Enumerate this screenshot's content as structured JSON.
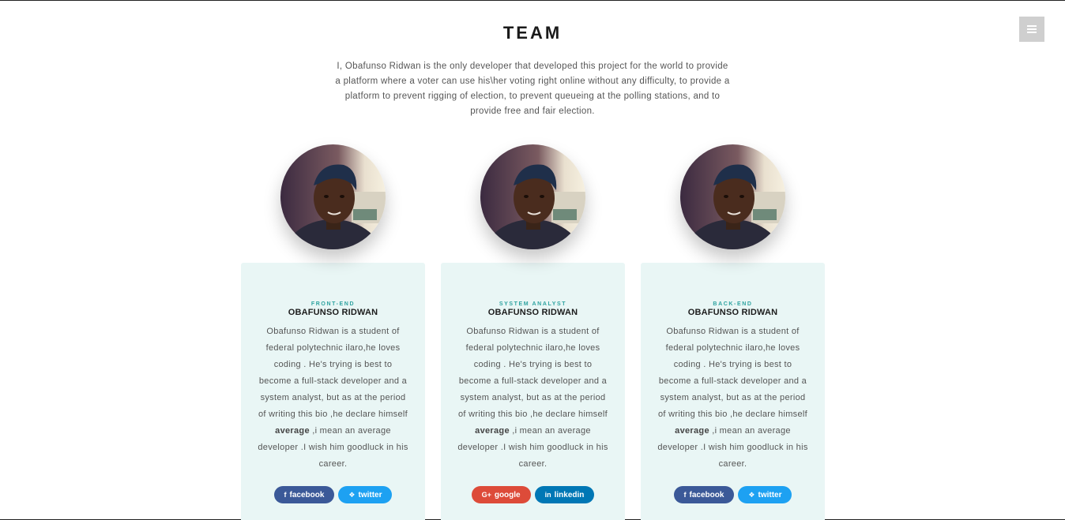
{
  "header": {
    "title": "TEAM",
    "intro": "I, Obafunso Ridwan is the only developer that developed this project for the world to provide a platform where a voter can use his\\her voting right online without any difficulty, to provide a platform to prevent rigging of election, to prevent queueing at the polling stations, and to provide free and fair election."
  },
  "menu": {
    "icon": "hamburger-menu-icon"
  },
  "bio": {
    "before": "Obafunso Ridwan is a student of federal polytechnic ilaro,he loves coding . He's trying is best to become a full-stack developer and a system analyst, but as at the period of writing this bio ,he declare himself ",
    "emphasis": "average",
    "after": " ,i mean an average developer .I wish him goodluck in his career."
  },
  "members": [
    {
      "role": "FRONT-END",
      "name": "OBAFUNSO RIDWAN",
      "socials": [
        {
          "icon": "f",
          "label": "facebook",
          "kind": "facebook",
          "color": "#3b5998"
        },
        {
          "icon": "❖",
          "label": "twitter",
          "kind": "twitter",
          "color": "#1da1f2"
        }
      ]
    },
    {
      "role": "SYSTEM ANALYST",
      "name": "OBAFUNSO RIDWAN",
      "socials": [
        {
          "icon": "G+",
          "label": "google",
          "kind": "google",
          "color": "#dd4b39"
        },
        {
          "icon": "in",
          "label": "linkedin",
          "kind": "linkedin",
          "color": "#0077b5"
        }
      ]
    },
    {
      "role": "BACK-END",
      "name": "OBAFUNSO RIDWAN",
      "socials": [
        {
          "icon": "f",
          "label": "facebook",
          "kind": "facebook",
          "color": "#3b5998"
        },
        {
          "icon": "❖",
          "label": "twitter",
          "kind": "twitter",
          "color": "#1da1f2"
        }
      ]
    }
  ],
  "colors": {
    "card_bg": "#e9f6f5",
    "role_accent": "#2fa3a0",
    "menu_bg": "#cfcfcf"
  }
}
